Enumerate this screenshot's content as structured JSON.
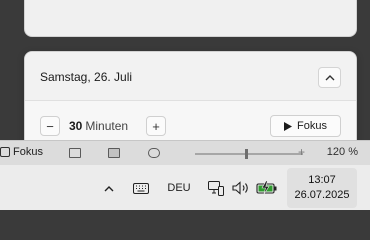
{
  "app_strip": {
    "focus_label": "Fokus",
    "zoom_label": "120 %"
  },
  "focus_panel": {
    "date_label": "Samstag, 26. Juli",
    "minutes_value": "30",
    "minutes_unit": "Minuten",
    "minus_label": "−",
    "plus_label": "+",
    "focus_button_label": "Fokus"
  },
  "taskbar": {
    "language": "DEU",
    "time": "13:07",
    "date": "26.07.2025",
    "battery_color": "#2e9b2e"
  },
  "icons": [
    "chevron-up-icon",
    "play-icon",
    "keyboard-icon",
    "network-icon",
    "volume-icon",
    "battery-charging-icon"
  ]
}
